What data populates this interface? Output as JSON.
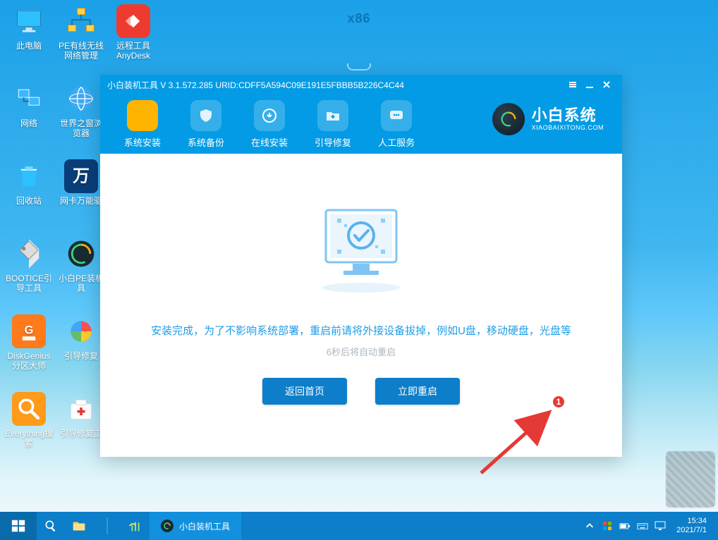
{
  "top_tag": "x86",
  "desktop_icons": [
    {
      "id": "this-pc",
      "label": "此电脑"
    },
    {
      "id": "pe-net-mgr",
      "label": "PE有线无线网络管理"
    },
    {
      "id": "anydesk",
      "label": "远程工具AnyDesk"
    },
    {
      "id": "network",
      "label": "网络"
    },
    {
      "id": "world-browser",
      "label": "世界之窗浏览器"
    },
    {
      "id": "recycle-bin",
      "label": "回收站"
    },
    {
      "id": "driver-tool",
      "label": "网卡万能驱"
    },
    {
      "id": "bootice",
      "label": "BOOTICE引导工具"
    },
    {
      "id": "xiaobai-pe",
      "label": "小白PE装机具"
    },
    {
      "id": "diskgenius",
      "label": "DiskGenius分区大师"
    },
    {
      "id": "boot-repair",
      "label": "引导修复"
    },
    {
      "id": "everything",
      "label": "Everything搜索"
    },
    {
      "id": "boot-repair-tool",
      "label": "引导修复工"
    }
  ],
  "app": {
    "title": "小白装机工具 V 3.1.572.285 URID:CDFF5A594C09E191E5FBBB5B226C4C44",
    "tabs": [
      {
        "id": "install",
        "label": "系统安装",
        "active": true
      },
      {
        "id": "backup",
        "label": "系统备份"
      },
      {
        "id": "online",
        "label": "在线安装"
      },
      {
        "id": "bootfix",
        "label": "引导修复"
      },
      {
        "id": "support",
        "label": "人工服务"
      }
    ],
    "brand_big": "小白系统",
    "brand_small": "XIAOBAIXITONG.COM",
    "msg1": "安装完成，为了不影响系统部署，重启前请将外接设备拔掉，例如U盘，移动硬盘，光盘等",
    "msg2": "6秒后将自动重启",
    "btn_back": "返回首页",
    "btn_restart": "立即重启",
    "badge": "1"
  },
  "taskbar": {
    "task_label": "小白装机工具",
    "time": "15:34",
    "date": "2021/7/1"
  }
}
